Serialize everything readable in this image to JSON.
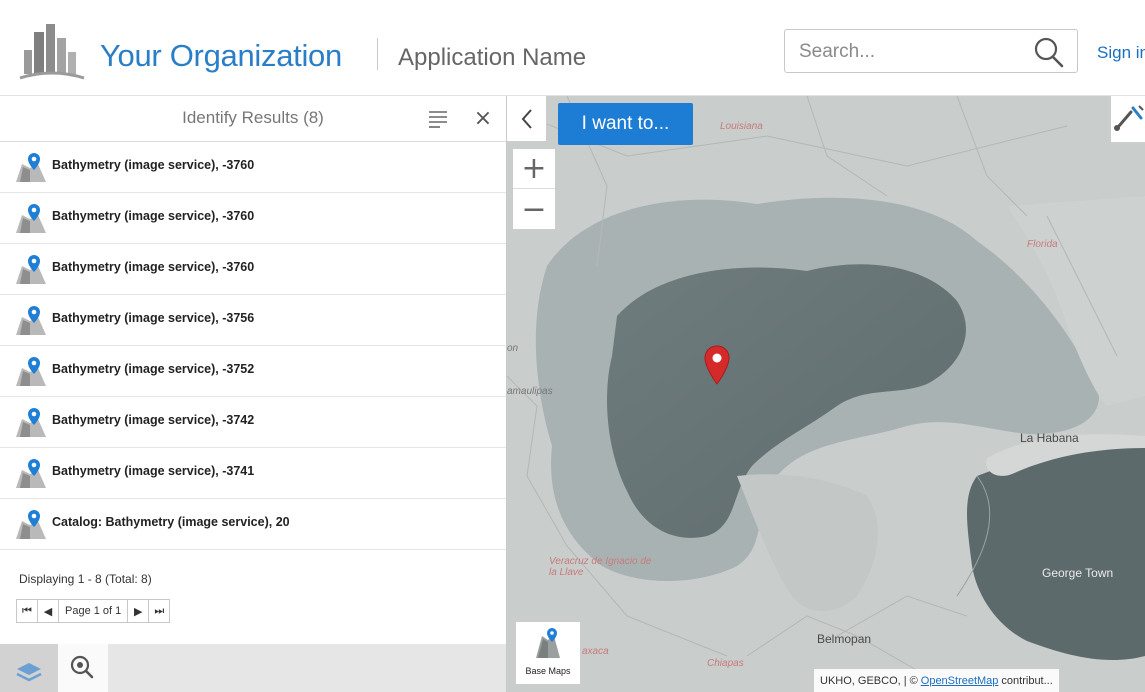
{
  "header": {
    "org_name": "Your Organization",
    "app_name": "Application Name",
    "search_placeholder": "Search...",
    "sign_in": "Sign in",
    "accent_color": "#2a7ec7"
  },
  "panel": {
    "title": "Identify Results (8)",
    "close_glyph": "×",
    "results": [
      {
        "label": "Bathymetry (image service), -3760",
        "icon": "map-pin-layer-icon"
      },
      {
        "label": "Bathymetry (image service), -3760",
        "icon": "map-pin-layer-icon"
      },
      {
        "label": "Bathymetry (image service), -3760",
        "icon": "map-pin-layer-icon"
      },
      {
        "label": "Bathymetry (image service), -3756",
        "icon": "map-pin-layer-icon"
      },
      {
        "label": "Bathymetry (image service), -3752",
        "icon": "map-pin-layer-icon"
      },
      {
        "label": "Bathymetry (image service), -3742",
        "icon": "map-pin-layer-icon"
      },
      {
        "label": "Bathymetry (image service), -3741",
        "icon": "map-pin-layer-icon"
      },
      {
        "label": "Catalog: Bathymetry (image service), 20",
        "icon": "map-pin-layer-icon"
      }
    ],
    "paging_info": "Displaying 1 - 8 (Total: 8)",
    "pager": {
      "first": "⏮",
      "prev": "◀",
      "page_label": "Page 1 of 1",
      "next": "▶",
      "last": "⏭"
    },
    "tabs": [
      "layers-icon",
      "identify-icon"
    ]
  },
  "map": {
    "iwant_label": "I want to...",
    "zoom_in": "+",
    "zoom_out": "−",
    "collapse_glyph": "‹",
    "basemaps_label": "Base Maps",
    "attribution_prefix": "UKHO, GEBCO, | ©",
    "attribution_link": "OpenStreetMap",
    "attribution_suffix": "contribut...",
    "places": {
      "louisiana": "Louisiana",
      "florida": "Florida",
      "la_habana": "La Habana",
      "george_town": "George Town",
      "belmopan": "Belmopan",
      "tamaulipas": "amaulipas",
      "on": "on",
      "veracruz": "Veracruz de Ignacio de la Llave",
      "chiapas": "Chiapas",
      "oaxaca": "axaca"
    },
    "pin_color": "#d42a2a"
  }
}
